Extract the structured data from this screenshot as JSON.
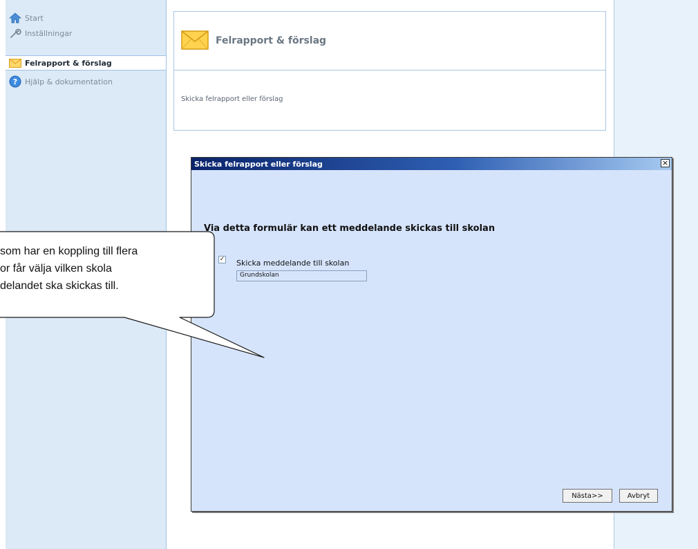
{
  "sidebar": {
    "items": [
      {
        "label": "Start",
        "icon": "home-icon"
      },
      {
        "label": "Inställningar",
        "icon": "wrench-icon"
      },
      {
        "label": "Felrapport & förslag",
        "icon": "envelope-icon"
      },
      {
        "label": "Hjälp & dokumentation",
        "icon": "help-icon"
      }
    ]
  },
  "header": {
    "title": "Felrapport & förslag",
    "description": "Skicka felrapport eller förslag"
  },
  "dialog": {
    "title": "Skicka felrapport eller förslag",
    "close_label": "×",
    "heading": "Via detta formulär kan ett meddelande skickas till skolan",
    "checkbox_label": "Skicka meddelande till skolan",
    "checkbox_mark": "✓",
    "school_value": "Grundskolan",
    "next_label": "Nästa>>",
    "cancel_label": "Avbryt"
  },
  "callout": {
    "lines": [
      "som har en koppling till flera",
      "or får välja vilken skola",
      "delandet ska skickas till."
    ]
  },
  "colors": {
    "sidebar_bg": "#dce9f6",
    "dialog_bg": "#d6e4fb",
    "titlebar_start": "#0a246a",
    "titlebar_end": "#a6caf0"
  }
}
